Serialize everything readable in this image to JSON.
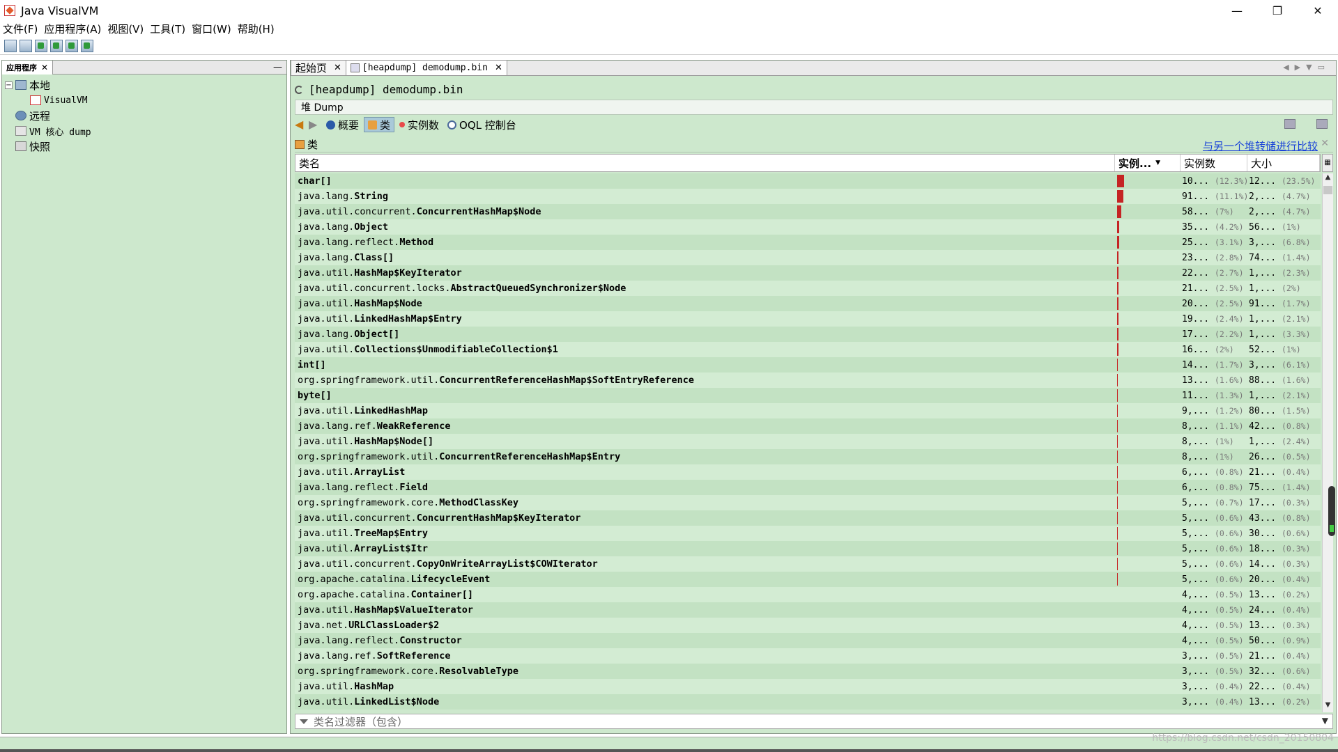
{
  "window": {
    "title": "Java VisualVM",
    "minimize": "—",
    "maximize": "❐",
    "close": "✕"
  },
  "menu": [
    "文件(F)",
    "应用程序(A)",
    "视图(V)",
    "工具(T)",
    "窗口(W)",
    "帮助(H)"
  ],
  "left_panel": {
    "tab_label": "应用程序",
    "tree": [
      {
        "label": "本地",
        "expander": "−"
      },
      {
        "label": "VisualVM"
      },
      {
        "label": "远程"
      },
      {
        "label": "VM 核心 dump"
      },
      {
        "label": "快照"
      }
    ]
  },
  "tabs": [
    {
      "label": "起始页"
    },
    {
      "label": "[heapdump] demodump.bin"
    }
  ],
  "heap": {
    "title": "[heapdump] demodump.bin",
    "dump_label": "堆 Dump",
    "views": {
      "summary": "概要",
      "classes": "类",
      "instances": "实例数",
      "oql": "OQL 控制台"
    },
    "section_title": "类",
    "compare_link": "与另一个堆转储进行比较"
  },
  "table": {
    "headers": {
      "name": "类名",
      "bar": "实例...",
      "instances": "实例数",
      "size": "大小"
    },
    "rows": [
      {
        "pkg": "",
        "cls": "char[]",
        "inst": "10...",
        "inst_pct": "(12.3%)",
        "size": "12...",
        "size_pct": "(23.5%)",
        "bar": 12.3
      },
      {
        "pkg": "java.lang.",
        "cls": "String",
        "inst": "91...",
        "inst_pct": "(11.1%)",
        "size": "2,...",
        "size_pct": "(4.7%)",
        "bar": 11.1
      },
      {
        "pkg": "java.util.concurrent.",
        "cls": "ConcurrentHashMap$Node",
        "inst": "58...",
        "inst_pct": "(7%)",
        "size": "2,...",
        "size_pct": "(4.7%)",
        "bar": 7
      },
      {
        "pkg": "java.lang.",
        "cls": "Object",
        "inst": "35...",
        "inst_pct": "(4.2%)",
        "size": "56...",
        "size_pct": "(1%)",
        "bar": 4.2
      },
      {
        "pkg": "java.lang.reflect.",
        "cls": "Method",
        "inst": "25...",
        "inst_pct": "(3.1%)",
        "size": "3,...",
        "size_pct": "(6.8%)",
        "bar": 3.1
      },
      {
        "pkg": "java.lang.",
        "cls": "Class[]",
        "inst": "23...",
        "inst_pct": "(2.8%)",
        "size": "74...",
        "size_pct": "(1.4%)",
        "bar": 2.8
      },
      {
        "pkg": "java.util.",
        "cls": "HashMap$KeyIterator",
        "inst": "22...",
        "inst_pct": "(2.7%)",
        "size": "1,...",
        "size_pct": "(2.3%)",
        "bar": 2.7
      },
      {
        "pkg": "java.util.concurrent.locks.",
        "cls": "AbstractQueuedSynchronizer$Node",
        "inst": "21...",
        "inst_pct": "(2.5%)",
        "size": "1,...",
        "size_pct": "(2%)",
        "bar": 2.5
      },
      {
        "pkg": "java.util.",
        "cls": "HashMap$Node",
        "inst": "20...",
        "inst_pct": "(2.5%)",
        "size": "91...",
        "size_pct": "(1.7%)",
        "bar": 2.5
      },
      {
        "pkg": "java.util.",
        "cls": "LinkedHashMap$Entry",
        "inst": "19...",
        "inst_pct": "(2.4%)",
        "size": "1,...",
        "size_pct": "(2.1%)",
        "bar": 2.4
      },
      {
        "pkg": "java.lang.",
        "cls": "Object[]",
        "inst": "17...",
        "inst_pct": "(2.2%)",
        "size": "1,...",
        "size_pct": "(3.3%)",
        "bar": 2.2
      },
      {
        "pkg": "java.util.",
        "cls": "Collections$UnmodifiableCollection$1",
        "inst": "16...",
        "inst_pct": "(2%)",
        "size": "52...",
        "size_pct": "(1%)",
        "bar": 2
      },
      {
        "pkg": "",
        "cls": "int[]",
        "inst": "14...",
        "inst_pct": "(1.7%)",
        "size": "3,...",
        "size_pct": "(6.1%)",
        "bar": 1.7
      },
      {
        "pkg": "org.springframework.util.",
        "cls": "ConcurrentReferenceHashMap$SoftEntryReference",
        "inst": "13...",
        "inst_pct": "(1.6%)",
        "size": "88...",
        "size_pct": "(1.6%)",
        "bar": 1.6
      },
      {
        "pkg": "",
        "cls": "byte[]",
        "inst": "11...",
        "inst_pct": "(1.3%)",
        "size": "1,...",
        "size_pct": "(2.1%)",
        "bar": 1.3
      },
      {
        "pkg": "java.util.",
        "cls": "LinkedHashMap",
        "inst": "9,...",
        "inst_pct": "(1.2%)",
        "size": "80...",
        "size_pct": "(1.5%)",
        "bar": 1.2
      },
      {
        "pkg": "java.lang.ref.",
        "cls": "WeakReference",
        "inst": "8,...",
        "inst_pct": "(1.1%)",
        "size": "42...",
        "size_pct": "(0.8%)",
        "bar": 1.1
      },
      {
        "pkg": "java.util.",
        "cls": "HashMap$Node[]",
        "inst": "8,...",
        "inst_pct": "(1%)",
        "size": "1,...",
        "size_pct": "(2.4%)",
        "bar": 1
      },
      {
        "pkg": "org.springframework.util.",
        "cls": "ConcurrentReferenceHashMap$Entry",
        "inst": "8,...",
        "inst_pct": "(1%)",
        "size": "26...",
        "size_pct": "(0.5%)",
        "bar": 1
      },
      {
        "pkg": "java.util.",
        "cls": "ArrayList",
        "inst": "6,...",
        "inst_pct": "(0.8%)",
        "size": "21...",
        "size_pct": "(0.4%)",
        "bar": 0.8
      },
      {
        "pkg": "java.lang.reflect.",
        "cls": "Field",
        "inst": "6,...",
        "inst_pct": "(0.8%)",
        "size": "75...",
        "size_pct": "(1.4%)",
        "bar": 0.8
      },
      {
        "pkg": "org.springframework.core.",
        "cls": "MethodClassKey",
        "inst": "5,...",
        "inst_pct": "(0.7%)",
        "size": "17...",
        "size_pct": "(0.3%)",
        "bar": 0.7
      },
      {
        "pkg": "java.util.concurrent.",
        "cls": "ConcurrentHashMap$KeyIterator",
        "inst": "5,...",
        "inst_pct": "(0.6%)",
        "size": "43...",
        "size_pct": "(0.8%)",
        "bar": 0.6
      },
      {
        "pkg": "java.util.",
        "cls": "TreeMap$Entry",
        "inst": "5,...",
        "inst_pct": "(0.6%)",
        "size": "30...",
        "size_pct": "(0.6%)",
        "bar": 0.6
      },
      {
        "pkg": "java.util.",
        "cls": "ArrayList$Itr",
        "inst": "5,...",
        "inst_pct": "(0.6%)",
        "size": "18...",
        "size_pct": "(0.3%)",
        "bar": 0.6
      },
      {
        "pkg": "java.util.concurrent.",
        "cls": "CopyOnWriteArrayList$COWIterator",
        "inst": "5,...",
        "inst_pct": "(0.6%)",
        "size": "14...",
        "size_pct": "(0.3%)",
        "bar": 0.6
      },
      {
        "pkg": "org.apache.catalina.",
        "cls": "LifecycleEvent",
        "inst": "5,...",
        "inst_pct": "(0.6%)",
        "size": "20...",
        "size_pct": "(0.4%)",
        "bar": 0.6
      },
      {
        "pkg": "org.apache.catalina.",
        "cls": "Container[]",
        "inst": "4,...",
        "inst_pct": "(0.5%)",
        "size": "13...",
        "size_pct": "(0.2%)",
        "bar": 0.5
      },
      {
        "pkg": "java.util.",
        "cls": "HashMap$ValueIterator",
        "inst": "4,...",
        "inst_pct": "(0.5%)",
        "size": "24...",
        "size_pct": "(0.4%)",
        "bar": 0.5
      },
      {
        "pkg": "java.net.",
        "cls": "URLClassLoader$2",
        "inst": "4,...",
        "inst_pct": "(0.5%)",
        "size": "13...",
        "size_pct": "(0.3%)",
        "bar": 0.5
      },
      {
        "pkg": "java.lang.reflect.",
        "cls": "Constructor",
        "inst": "4,...",
        "inst_pct": "(0.5%)",
        "size": "50...",
        "size_pct": "(0.9%)",
        "bar": 0.5
      },
      {
        "pkg": "java.lang.ref.",
        "cls": "SoftReference",
        "inst": "3,...",
        "inst_pct": "(0.5%)",
        "size": "21...",
        "size_pct": "(0.4%)",
        "bar": 0.5
      },
      {
        "pkg": "org.springframework.core.",
        "cls": "ResolvableType",
        "inst": "3,...",
        "inst_pct": "(0.5%)",
        "size": "32...",
        "size_pct": "(0.6%)",
        "bar": 0.5
      },
      {
        "pkg": "java.util.",
        "cls": "HashMap",
        "inst": "3,...",
        "inst_pct": "(0.4%)",
        "size": "22...",
        "size_pct": "(0.4%)",
        "bar": 0.4
      },
      {
        "pkg": "java.util.",
        "cls": "LinkedList$Node",
        "inst": "3,...",
        "inst_pct": "(0.4%)",
        "size": "13...",
        "size_pct": "(0.2%)",
        "bar": 0.4
      }
    ]
  },
  "filter": {
    "placeholder": "类名过滤器（包含）"
  },
  "watermark": "https://blog.csdn.net/csdn_20150804",
  "colors": {
    "panel_bg": "#cde8cd",
    "bar_fill": "#c52424",
    "link": "#1a44d8"
  }
}
